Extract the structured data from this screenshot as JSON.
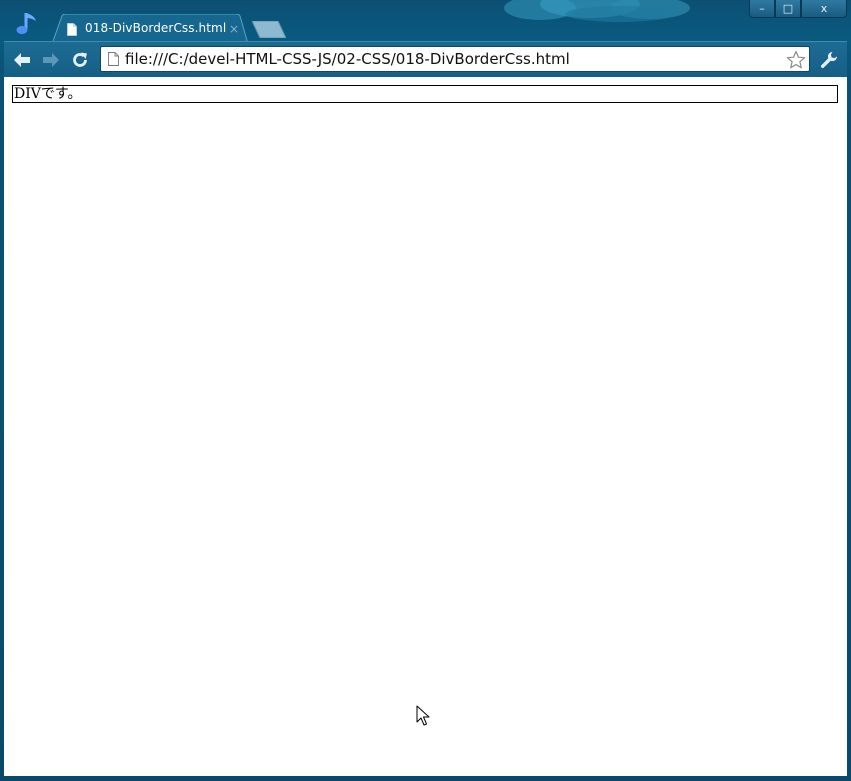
{
  "window": {
    "controls": {
      "minimize": "–",
      "maximize": "□",
      "close": "x"
    }
  },
  "tab": {
    "title": "018-DivBorderCss.html",
    "close": "×"
  },
  "toolbar": {
    "back_icon": "back-arrow-icon",
    "forward_icon": "forward-arrow-icon",
    "reload_icon": "reload-icon",
    "url": "file:///C:/devel-HTML-CSS-JS/02-CSS/018-DivBorderCss.html",
    "bookmark_icon": "star-icon",
    "menu_icon": "wrench-icon"
  },
  "content": {
    "div_text": "DIVです。"
  },
  "colors": {
    "frame": "#0a5175",
    "toolbar": "#1a6891",
    "accent": "#7fb3cc"
  }
}
